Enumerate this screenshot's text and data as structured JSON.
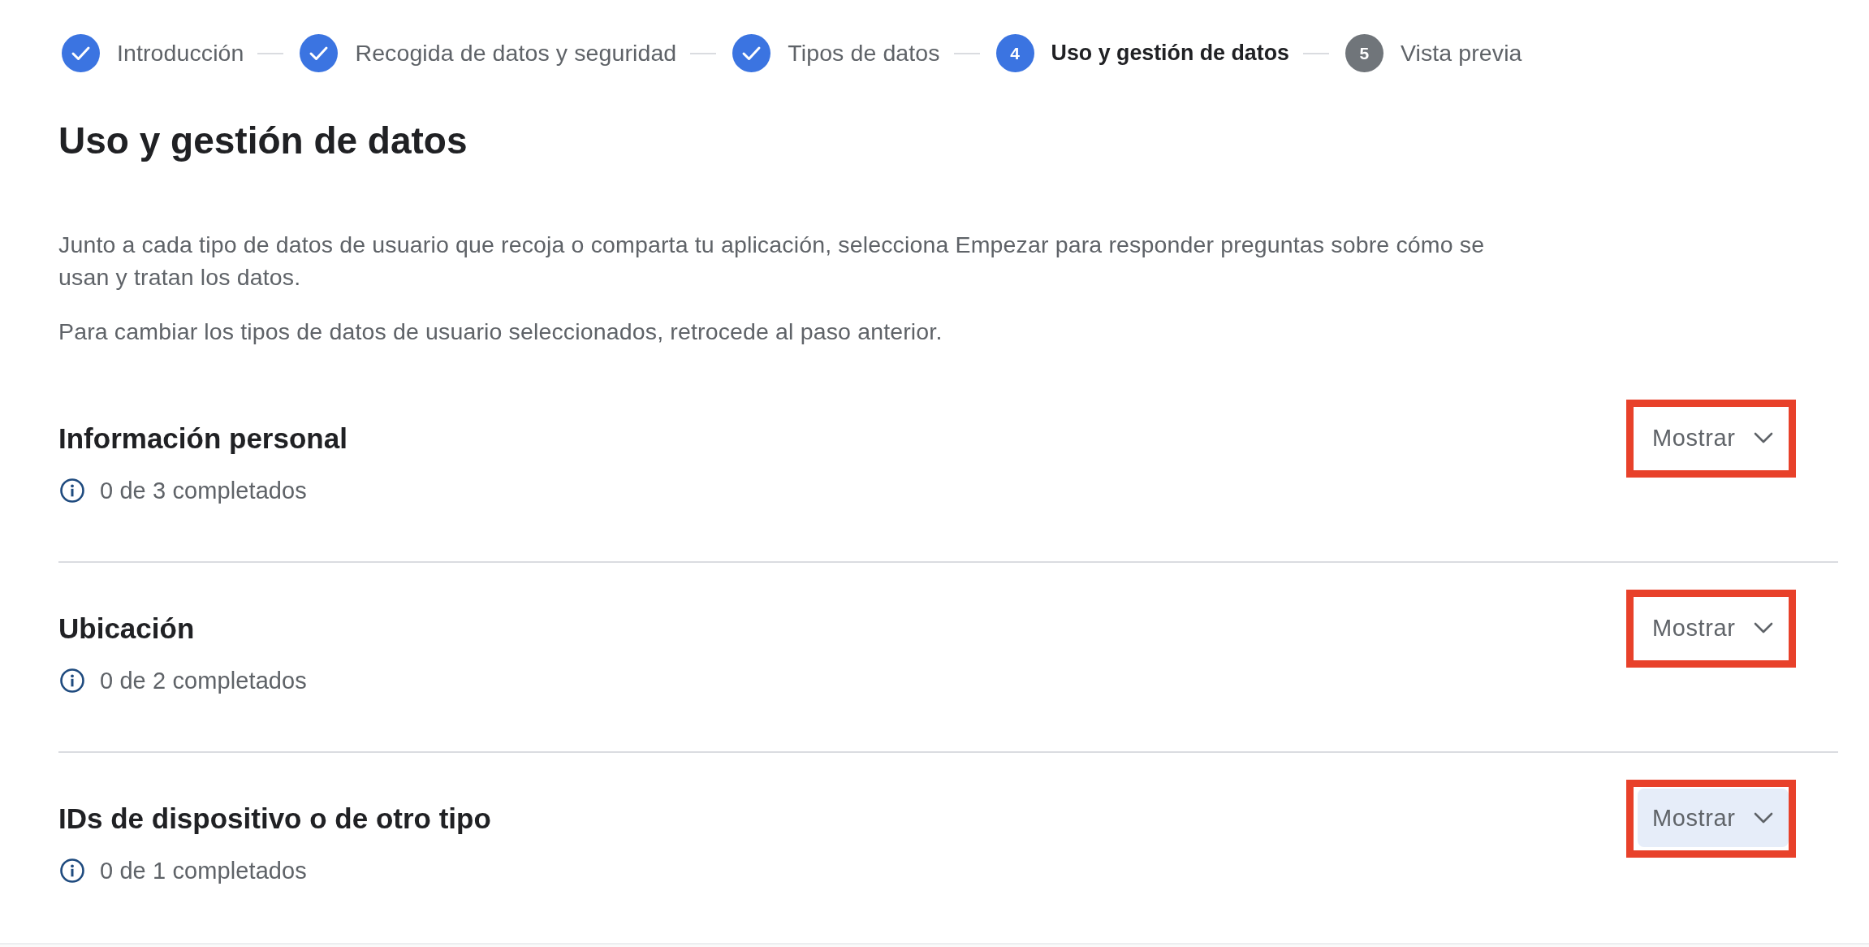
{
  "stepper": {
    "steps": [
      {
        "label": "Introducción",
        "kind": "done"
      },
      {
        "label": "Recogida de datos y seguridad",
        "kind": "done"
      },
      {
        "label": "Tipos de datos",
        "kind": "done"
      },
      {
        "number": "4",
        "label": "Uso y gestión de datos",
        "kind": "current"
      },
      {
        "number": "5",
        "label": "Vista previa",
        "kind": "upcoming"
      }
    ]
  },
  "page": {
    "title": "Uso y gestión de datos",
    "paragraphs": [
      "Junto a cada tipo de datos de usuario que recoja o comparta tu aplicación, selecciona Empezar para responder preguntas sobre cómo se usan y tratan los datos.",
      "Para cambiar los tipos de datos de usuario seleccionados, retrocede al paso anterior."
    ]
  },
  "sections": [
    {
      "title": "Información personal",
      "progress": "0 de 3 completados",
      "highlighted": true,
      "button": {
        "label": "Mostrar",
        "hovered": false
      }
    },
    {
      "title": "Ubicación",
      "progress": "0 de 2 completados",
      "highlighted": true,
      "button": {
        "label": "Mostrar",
        "hovered": false
      }
    },
    {
      "title": "IDs de dispositivo o de otro tipo",
      "progress": "0 de 1 completados",
      "highlighted": true,
      "button": {
        "label": "Mostrar",
        "hovered": true
      }
    }
  ]
}
